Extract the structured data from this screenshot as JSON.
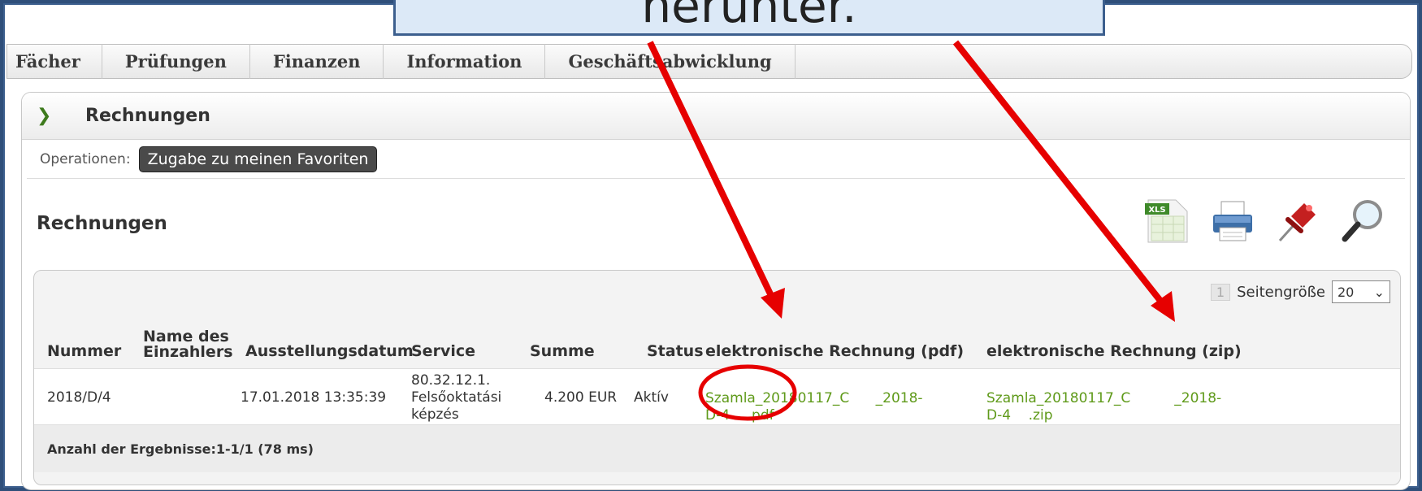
{
  "callout": {
    "text": "herunter."
  },
  "menu": {
    "items": [
      "Fächer",
      "Prüfungen",
      "Finanzen",
      "Information",
      "Geschäftsabwicklung"
    ]
  },
  "panel": {
    "title": "Rechnungen",
    "operations_label": "Operationen:",
    "favorites_button": "Zugabe zu meinen Favoriten",
    "section_title": "Rechnungen"
  },
  "toolbar": {
    "icons": [
      "xls-export-icon",
      "print-icon",
      "pin-icon",
      "search-icon"
    ],
    "xls_label": "XLS"
  },
  "pager": {
    "page": "1",
    "page_size_label": "Seitengröße",
    "page_size_value": "20"
  },
  "table": {
    "headers": {
      "nummer": "Nummer",
      "einzahler_line1": "Name des",
      "einzahler_line2": "Einzahlers",
      "datum": "Ausstellungsdatum",
      "service": "Service",
      "summe": "Summe",
      "status": "Status",
      "pdf": "elektronische Rechnung (pdf)",
      "zip": "elektronische Rechnung (zip)"
    },
    "rows": [
      {
        "nummer": "2018/D/4",
        "einzahler": "",
        "datum": "17.01.2018 13:35:39",
        "service_line1": "80.32.12.1.",
        "service_line2": "Felsőoktatási",
        "service_line3": "képzés",
        "summe": "4.200 EUR",
        "status": "Aktív",
        "pdf_line1": "Szamla_20180117_C      _2018-",
        "pdf_line2": "D-4    .pdf",
        "zip_line1": "Szamla_20180117_C          _2018-",
        "zip_line2": "D-4    .zip"
      }
    ]
  },
  "footer": {
    "results": "Anzahl der Ergebnisse:1-1/1 (78 ms)"
  },
  "colors": {
    "link": "#5f9a1a",
    "arrow": "#e60000",
    "frame": "#3c5f8e"
  }
}
